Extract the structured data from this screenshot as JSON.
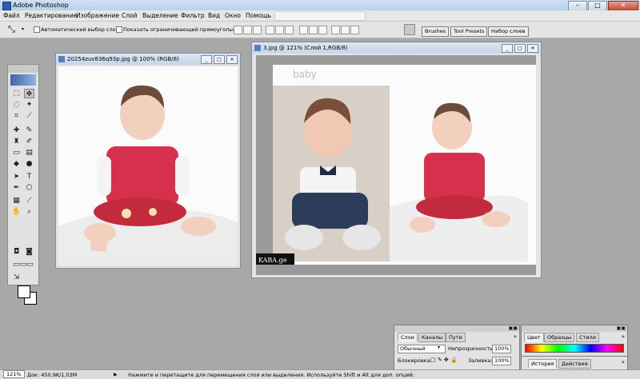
{
  "app": {
    "title": "Adobe Photoshop"
  },
  "menu": [
    "Файл",
    "Редактирование",
    "Изображение",
    "Слой",
    "Выделение",
    "Фильтр",
    "Вид",
    "Окно",
    "Помощь"
  ],
  "options": {
    "auto_select": "Автоматический выбор слоя",
    "show_bounds": "Показать ограничивающий прямоугольник"
  },
  "palette_well": [
    "Brushes",
    "Tool Presets",
    "Набор слоев"
  ],
  "doc1": {
    "title": "20254zuv836q93p.jpg @ 100% (RGB/8)"
  },
  "doc2": {
    "title": "3.jpg @ 121% (Слой 1,RGB/8)",
    "watermark": "baby",
    "caption": "KABA.ge"
  },
  "layers_panel": {
    "tabs": [
      "Слои",
      "Каналы",
      "Пути"
    ],
    "blend_mode": "Обычный",
    "opacity_label": "Непрозрачность:",
    "opacity_value": "100%",
    "lock_label": "Блокировка:",
    "fill_label": "Заливка:",
    "fill_value": "100%"
  },
  "color_panel": {
    "tabs": [
      "Цвет",
      "Образцы",
      "Стили"
    ]
  },
  "history_panel": {
    "tabs": [
      "История",
      "Действия"
    ]
  },
  "status": {
    "zoom": "121%",
    "doc_size": "Док: 450,9K/1,03M",
    "hint": "Нажмите и перетащите для перемещения слоя или выделения. Используйте Shift и Alt для доп. опций."
  }
}
